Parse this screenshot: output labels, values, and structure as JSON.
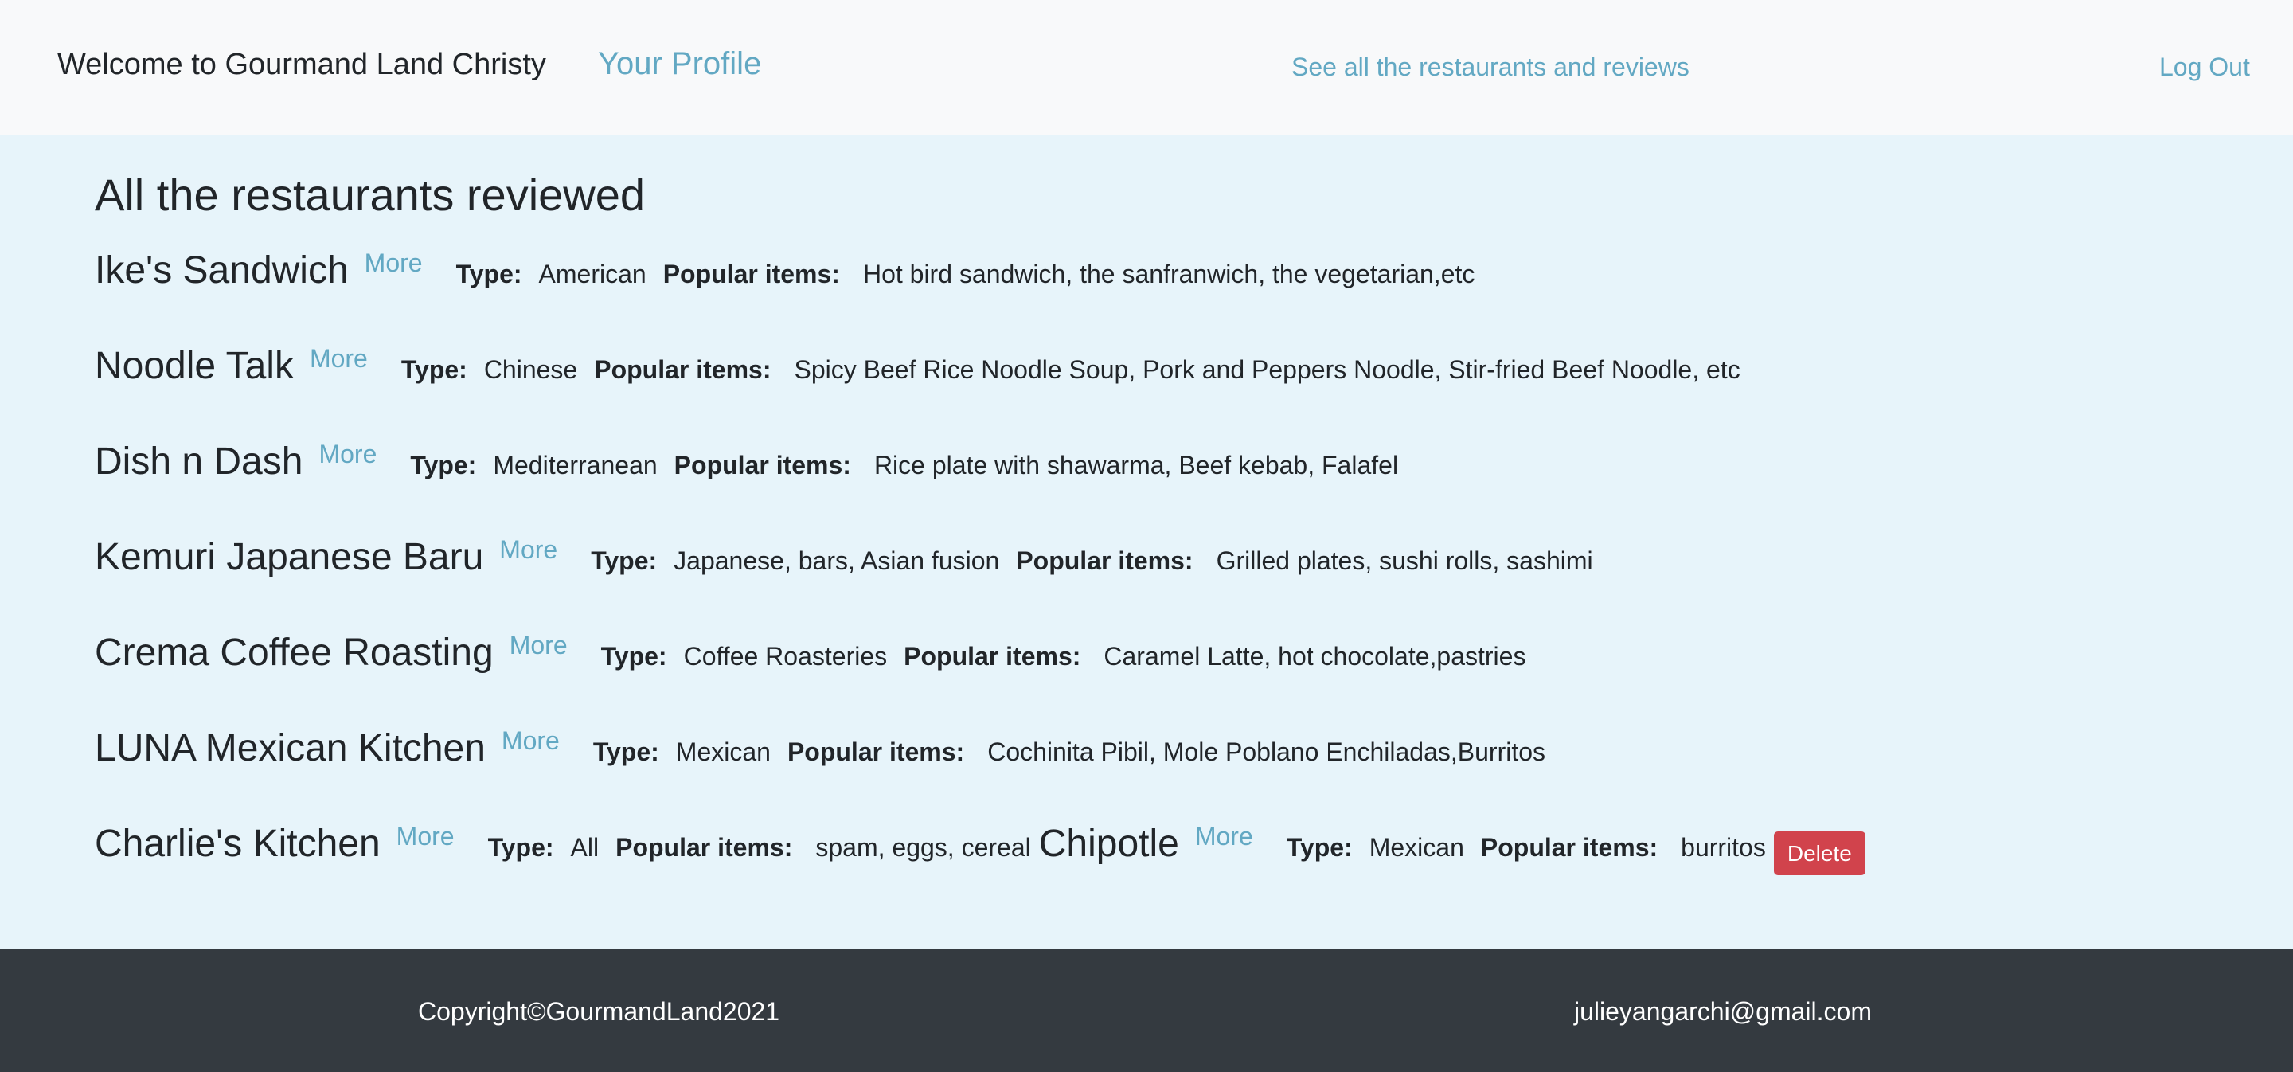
{
  "navbar": {
    "brand": "Welcome to Gourmand Land Christy",
    "profile_link": "Your Profile",
    "all_link": "See all the restaurants and reviews",
    "logout_link": "Log Out"
  },
  "main": {
    "title": "All the restaurants reviewed",
    "more_label": "More",
    "type_label": "Type:",
    "popular_label": "Popular items:",
    "delete_label": "Delete",
    "restaurants": [
      {
        "name": "Ike's Sandwich",
        "type": "American",
        "popular": "Hot bird sandwich, the sanfranwich, the vegetarian,etc"
      },
      {
        "name": "Noodle Talk",
        "type": "Chinese",
        "popular": "Spicy Beef Rice Noodle Soup, Pork and Peppers Noodle, Stir-fried Beef Noodle, etc"
      },
      {
        "name": "Dish n Dash",
        "type": "Mediterranean",
        "popular": "Rice plate with shawarma, Beef kebab, Falafel"
      },
      {
        "name": "Kemuri Japanese Baru",
        "type": "Japanese, bars, Asian fusion",
        "popular": "Grilled plates, sushi rolls, sashimi"
      },
      {
        "name": "Crema Coffee Roasting",
        "type": "Coffee Roasteries",
        "popular": "Caramel Latte, hot chocolate,pastries"
      },
      {
        "name": "LUNA Mexican Kitchen",
        "type": "Mexican",
        "popular": "Cochinita Pibil, Mole Poblano Enchiladas,Burritos"
      },
      {
        "name": "Charlie's Kitchen",
        "type": "All",
        "popular": "spam, eggs, cereal"
      },
      {
        "name": "Chipotle",
        "type": "Mexican",
        "popular": "burritos"
      }
    ]
  },
  "footer": {
    "copyright": "Copyright©GourmandLand2021",
    "email": "julieyangarchi@gmail.com"
  },
  "colors": {
    "link": "#62a8c3",
    "main_background": "#e7f4fa",
    "navbar_background": "#f8f9fa",
    "footer_background": "#343a40",
    "delete_button": "#d1434c"
  }
}
